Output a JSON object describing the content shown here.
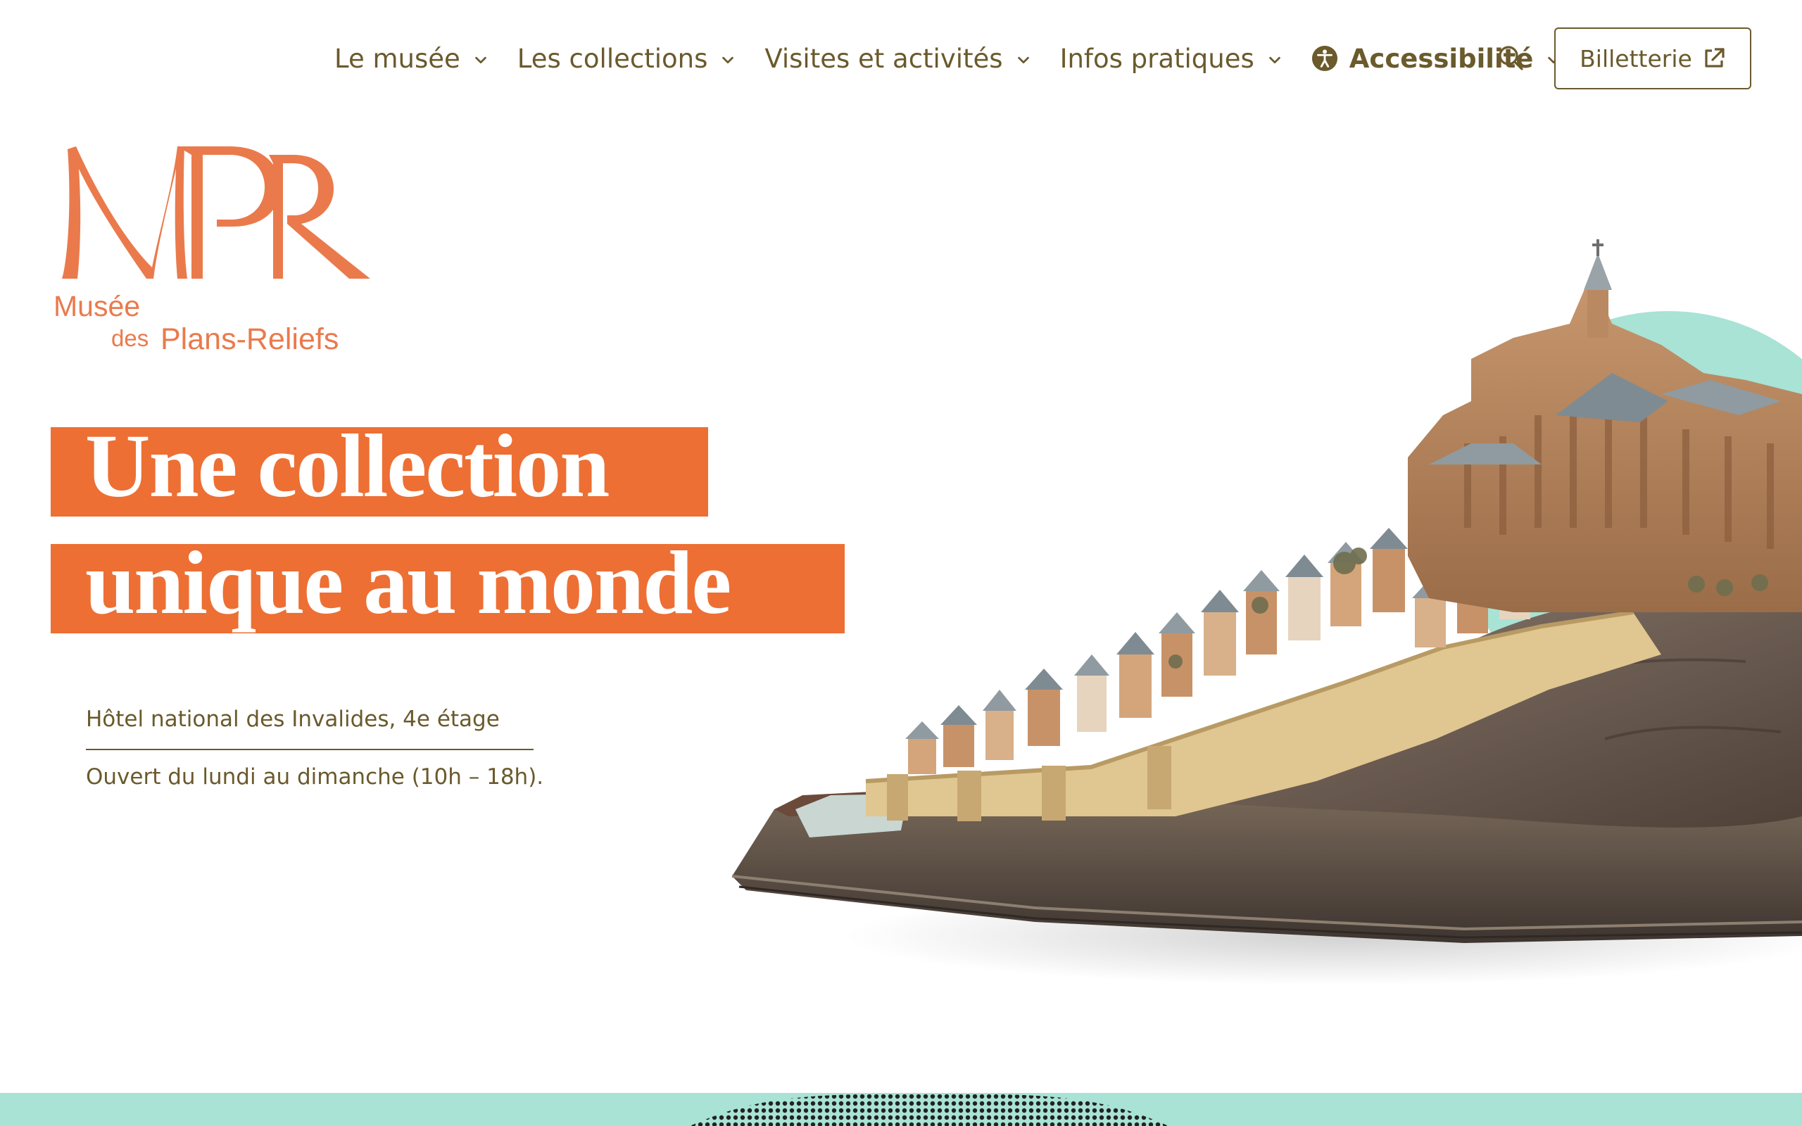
{
  "nav": {
    "items": [
      {
        "label": "Le musée"
      },
      {
        "label": "Les collections"
      },
      {
        "label": "Visites et activités"
      },
      {
        "label": "Infos pratiques"
      },
      {
        "label": "Accessibilité"
      }
    ],
    "search_icon": "search-icon",
    "ticket_label": "Billetterie",
    "ticket_icon": "external-link-icon"
  },
  "logo": {
    "monogram": "MPR",
    "line1": "Musée",
    "line2_small": "des",
    "line2": "Plans-Reliefs"
  },
  "hero": {
    "headline_line1": "Une collection",
    "headline_line2": "unique au monde",
    "address": "Hôtel national des Invalides, 4e étage",
    "hours": "Ouvert du lundi au dimanche (10h – 18h)."
  },
  "colors": {
    "brand_orange": "#ed6f34",
    "logo_orange": "#ea7a4c",
    "text_olive": "#6a5a2c",
    "accent_mint": "#a8e3d5"
  }
}
